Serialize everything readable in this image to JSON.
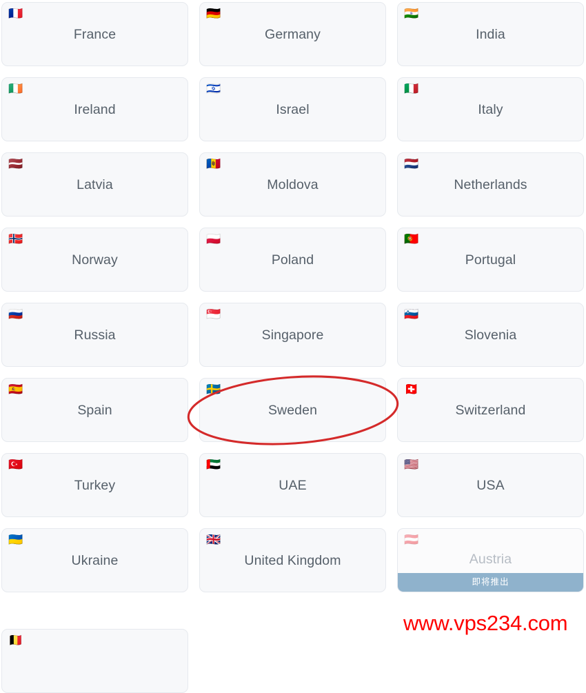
{
  "page": {
    "background_color": "#ffffff",
    "card_background_color": "#f7f8fa",
    "card_border_color": "#e6e9ee",
    "label_color": "#56606a",
    "disabled_label_color": "#b6bcc4",
    "annotation_color": "#d42a2a",
    "banner_color": "#8fb2cc",
    "watermark_color": "#fe0000"
  },
  "watermark": {
    "text": "www.vps234.com"
  },
  "annotation": {
    "type": "hand-drawn-ellipse",
    "targets": "Sweden",
    "color": "#d42a2a"
  },
  "grid": {
    "columns": 3,
    "cards": [
      {
        "name": "France",
        "flag": "🇫🇷",
        "flag_name": "flag-france",
        "disabled": false
      },
      {
        "name": "Germany",
        "flag": "🇩🇪",
        "flag_name": "flag-germany",
        "disabled": false
      },
      {
        "name": "India",
        "flag": "🇮🇳",
        "flag_name": "flag-india",
        "disabled": false
      },
      {
        "name": "Ireland",
        "flag": "🇮🇪",
        "flag_name": "flag-ireland",
        "disabled": false
      },
      {
        "name": "Israel",
        "flag": "🇮🇱",
        "flag_name": "flag-israel",
        "disabled": false
      },
      {
        "name": "Italy",
        "flag": "🇮🇹",
        "flag_name": "flag-italy",
        "disabled": false
      },
      {
        "name": "Latvia",
        "flag": "🇱🇻",
        "flag_name": "flag-latvia",
        "disabled": false
      },
      {
        "name": "Moldova",
        "flag": "🇲🇩",
        "flag_name": "flag-moldova",
        "disabled": false
      },
      {
        "name": "Netherlands",
        "flag": "🇳🇱",
        "flag_name": "flag-netherlands",
        "disabled": false
      },
      {
        "name": "Norway",
        "flag": "🇳🇴",
        "flag_name": "flag-norway",
        "disabled": false
      },
      {
        "name": "Poland",
        "flag": "🇵🇱",
        "flag_name": "flag-poland",
        "disabled": false
      },
      {
        "name": "Portugal",
        "flag": "🇵🇹",
        "flag_name": "flag-portugal",
        "disabled": false
      },
      {
        "name": "Russia",
        "flag": "🇷🇺",
        "flag_name": "flag-russia",
        "disabled": false
      },
      {
        "name": "Singapore",
        "flag": "🇸🇬",
        "flag_name": "flag-singapore",
        "disabled": false
      },
      {
        "name": "Slovenia",
        "flag": "🇸🇮",
        "flag_name": "flag-slovenia",
        "disabled": false
      },
      {
        "name": "Spain",
        "flag": "🇪🇸",
        "flag_name": "flag-spain",
        "disabled": false
      },
      {
        "name": "Sweden",
        "flag": "🇸🇪",
        "flag_name": "flag-sweden",
        "disabled": false
      },
      {
        "name": "Switzerland",
        "flag": "🇨🇭",
        "flag_name": "flag-switzerland",
        "disabled": false
      },
      {
        "name": "Turkey",
        "flag": "🇹🇷",
        "flag_name": "flag-turkey",
        "disabled": false
      },
      {
        "name": "UAE",
        "flag": "🇦🇪",
        "flag_name": "flag-uae",
        "disabled": false
      },
      {
        "name": "USA",
        "flag": "🇺🇸",
        "flag_name": "flag-usa",
        "disabled": false
      },
      {
        "name": "Ukraine",
        "flag": "🇺🇦",
        "flag_name": "flag-ukraine",
        "disabled": false
      },
      {
        "name": "United Kingdom",
        "flag": "🇬🇧",
        "flag_name": "flag-united-kingdom",
        "disabled": false
      },
      {
        "name": "Austria",
        "flag": "🇦🇹",
        "flag_name": "flag-austria",
        "disabled": true,
        "badge": "即将推出"
      }
    ]
  },
  "bottom_peek": {
    "flag": "🇧🇪",
    "flag_name": "flag-partial-next-row"
  }
}
